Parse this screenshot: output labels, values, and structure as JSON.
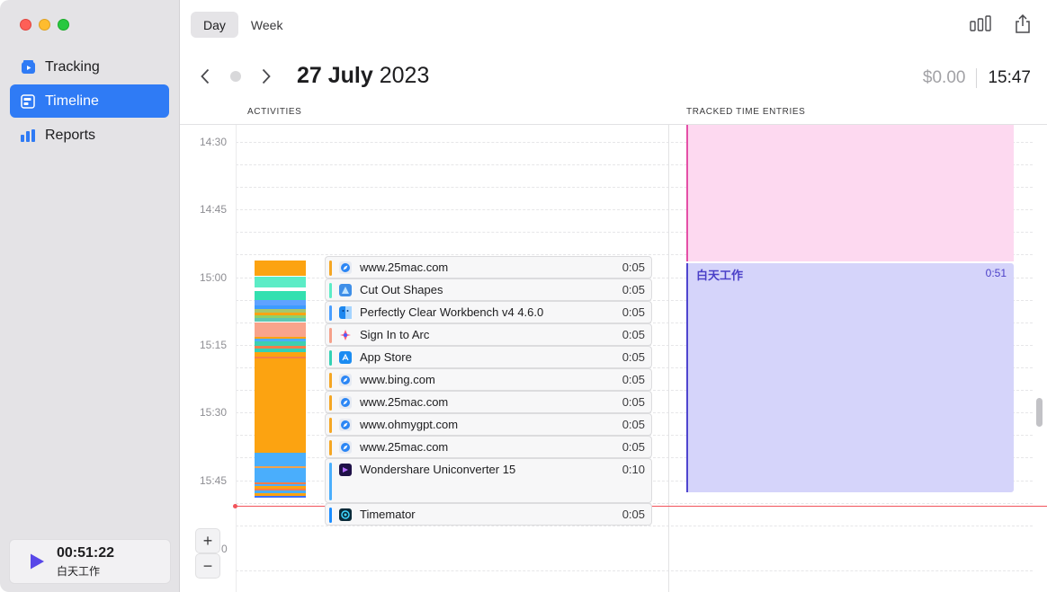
{
  "sidebar": {
    "items": [
      {
        "label": "Tracking",
        "icon": "tracking-icon"
      },
      {
        "label": "Timeline",
        "icon": "timeline-icon"
      },
      {
        "label": "Reports",
        "icon": "reports-icon"
      }
    ],
    "timer": {
      "time": "00:51:22",
      "label": "白天工作"
    }
  },
  "toolbar": {
    "tabs": [
      "Day",
      "Week"
    ],
    "active_tab": "Day",
    "icons": [
      "bar-chart-icon",
      "share-icon"
    ]
  },
  "header": {
    "date_bold": "27 July",
    "date_year": "2023",
    "money": "$0.00",
    "clock": "15:47"
  },
  "columns": {
    "activities": "ACTIVITIES",
    "tracked": "TRACKED TIME ENTRIES"
  },
  "time_ticks": [
    "14:30",
    "14:45",
    "15:00",
    "15:15",
    "15:30",
    "15:45"
  ],
  "zoom": {
    "plus": "+",
    "minus": "−",
    "value": "0"
  },
  "activities": [
    {
      "name": "www.25mac.com",
      "duration": "0:05",
      "stripe": "#f5a623",
      "icon": "safari-icon"
    },
    {
      "name": "Cut Out Shapes",
      "duration": "0:05",
      "stripe": "#5cecc6",
      "icon": "cut-out-shapes-icon"
    },
    {
      "name": "Perfectly Clear Workbench v4 4.6.0",
      "duration": "0:05",
      "stripe": "#4a9eff",
      "icon": "finder-icon"
    },
    {
      "name": "Sign In to Arc",
      "duration": "0:05",
      "stripe": "#f5a08a",
      "icon": "arc-icon"
    },
    {
      "name": "App Store",
      "duration": "0:05",
      "stripe": "#33d1b4",
      "icon": "app-store-icon"
    },
    {
      "name": "www.bing.com",
      "duration": "0:05",
      "stripe": "#f5a623",
      "icon": "safari-icon"
    },
    {
      "name": "www.25mac.com",
      "duration": "0:05",
      "stripe": "#f5a623",
      "icon": "safari-icon"
    },
    {
      "name": "www.ohmygpt.com",
      "duration": "0:05",
      "stripe": "#f5a623",
      "icon": "safari-icon"
    },
    {
      "name": "www.25mac.com",
      "duration": "0:05",
      "stripe": "#f5a623",
      "icon": "safari-icon"
    },
    {
      "name": "Wondershare Uniconverter 15",
      "duration": "0:10",
      "stripe": "#4aaefc",
      "icon": "uniconverter-icon"
    },
    {
      "name": "Timemator",
      "duration": "0:05",
      "stripe": "#1a8cff",
      "icon": "timemator-icon"
    }
  ],
  "time_entries": [
    {
      "title": "",
      "duration": "",
      "color": "#fdd9f0"
    },
    {
      "title": "白天工作",
      "duration": "0:51",
      "color": "#d5d4fa"
    }
  ],
  "colors": {
    "accent": "#2f7bf5",
    "now_line": "#f2545b",
    "orange": "#fca311",
    "blue_entry": "#4f45cf",
    "pink_entry": "#e54fa7"
  }
}
